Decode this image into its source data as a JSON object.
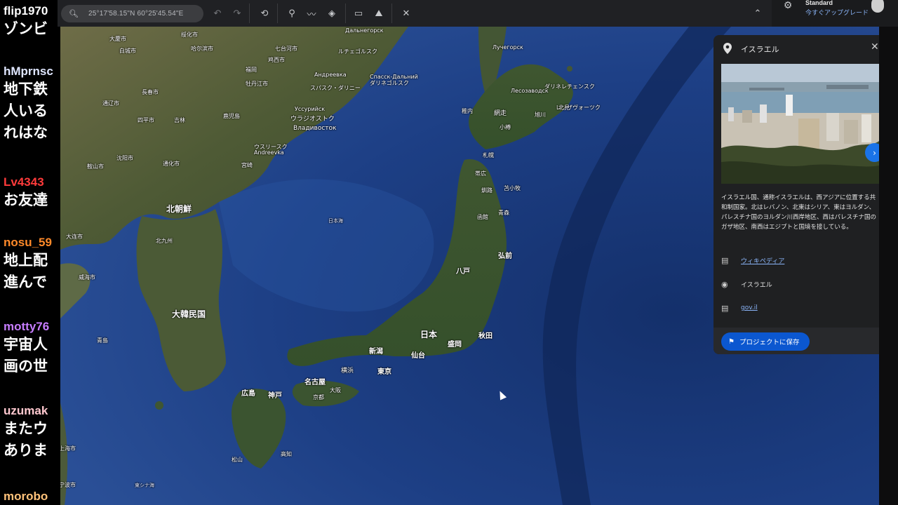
{
  "toolbar": {
    "search_value": "25°17'58.15\"N 60°25'45.54\"E",
    "buttons": [
      {
        "name": "undo-button",
        "icon": "undo-icon",
        "glyph": "↶"
      },
      {
        "name": "redo-button",
        "icon": "redo-icon",
        "glyph": "↷"
      },
      {
        "name": "history-button",
        "icon": "history-icon",
        "glyph": "⟲"
      },
      {
        "name": "add-placemark-button",
        "icon": "placemark-icon",
        "glyph": "⚲"
      },
      {
        "name": "add-path-button",
        "icon": "path-icon",
        "glyph": "〰"
      },
      {
        "name": "layers-button",
        "icon": "layers-icon",
        "glyph": "◈"
      },
      {
        "name": "measure-button",
        "icon": "ruler-icon",
        "glyph": "▭"
      },
      {
        "name": "elevation-button",
        "icon": "terrain-icon",
        "glyph": "⛰"
      },
      {
        "name": "tools-button",
        "icon": "satellite-icon",
        "glyph": "✕"
      }
    ],
    "collapse_icon": "chevron-up-icon"
  },
  "account": {
    "plan": "Standard",
    "upgrade": "今すぐアップグレード",
    "settings_icon": "gear-icon"
  },
  "chat": [
    {
      "user": "flip1970",
      "color": "#ffffff",
      "lines": [
        "ゾンビ"
      ]
    },
    {
      "user": "hMprnsc",
      "color": "#dfe6ff",
      "lines": [
        "地下鉄",
        "人いる",
        "れはな"
      ]
    },
    {
      "user": "Lv4343",
      "color": "#ff3b3b",
      "lines": [
        "お友達"
      ]
    },
    {
      "user": "nosu_59",
      "color": "#ff8a2a",
      "lines": [
        "地上配",
        "進んで"
      ]
    },
    {
      "user": "motty76",
      "color": "#c77dff",
      "lines": [
        "宇宙人",
        "画の世"
      ]
    },
    {
      "user": "uzumak",
      "color": "#ffc8cf",
      "lines": [
        "またウ",
        "ありま"
      ]
    },
    {
      "user": "morobo",
      "color": "#ffc27a",
      "lines": []
    }
  ],
  "map_labels": {
    "countries": [
      "北朝鮮",
      "大韓民国",
      "日本"
    ],
    "cities": [
      "大慶市",
      "绥化市",
      "白城市",
      "哈尔滨市",
      "七台河市",
      "鸡西市",
      "長春市",
      "通辽市",
      "四平市",
      "吉林",
      "牡丹江市",
      "沈阳市",
      "鞍山市",
      "通化市",
      "大连市",
      "威海市",
      "青島",
      "上海市",
      "宁波市",
      "東シナ海",
      "日本海",
      "ウラジオストク",
      "Владивосток",
      "Уссурийск",
      "ウスリースク",
      "Andreevka",
      "Андреевка",
      "スパスク・ダリニー",
      "Спасск-Дальний",
      "ダリネゴルスク",
      "Дальнегорск",
      "ルチェゴルスク",
      "Лучегорск",
      "レソザヴォーツク",
      "Лесозаводск",
      "ダリネレチェンスク",
      "稚内",
      "網走",
      "旭川",
      "北見",
      "小樽",
      "札幌",
      "帯広",
      "釧路",
      "苫小牧",
      "函館",
      "青森",
      "弘前",
      "八戸",
      "秋田",
      "盛岡",
      "仙台",
      "新潟",
      "東京",
      "横浜",
      "名古屋",
      "京都",
      "大阪",
      "神戸",
      "広島",
      "松山",
      "高知",
      "北九州",
      "福岡",
      "鹿児島",
      "宮崎",
      "平壌",
      "牡丹江市",
      "延吉市",
      "清津"
    ]
  },
  "panel": {
    "title": "イスラエル",
    "description": "イスラエル国、通称イスラエルは、西アジアに位置する共和制国家。北はレバノン、北東はシリア、東はヨルダン、パレスチナ国のヨルダン川西岸地区、西はパレスチナ国のガザ地区、南西はエジプトと国境を接している。",
    "links": [
      {
        "label": "ウィキペディア",
        "icon": "web-icon",
        "link": true
      },
      {
        "label": "イスラエル",
        "icon": "location-pin-icon",
        "link": false
      },
      {
        "label": "gov.il",
        "icon": "web-icon",
        "link": true
      }
    ],
    "save_label": "プロジェクトに保存",
    "save_icon": "bookmark-icon",
    "close_icon": "close-icon",
    "next_icon": "chevron-right-icon"
  }
}
